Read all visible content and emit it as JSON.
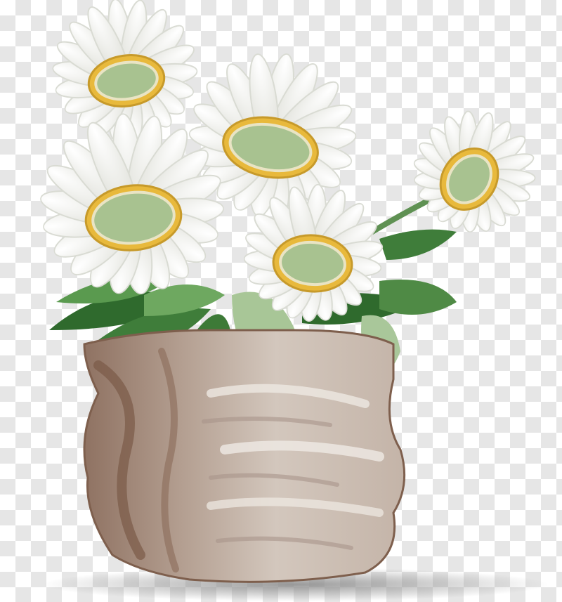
{
  "image": {
    "subject": "daisy-bouquet-in-bark-pot",
    "background": "transparency-checkerboard",
    "flower_count": 5,
    "colors": {
      "checker_light": "#ffffff",
      "checker_dark": "#e6e6e6",
      "petal": "#f3f3ef",
      "petal_shade": "#d9dbd3",
      "center_ring": "#e8b93c",
      "center_disc": "#a8c290",
      "leaf": "#4f8a45",
      "leaf_dark": "#2f5f2c",
      "leaf_pale": "#a9c79a",
      "pot_light": "#d6cbc2",
      "pot_mid": "#b8a596",
      "pot_dark": "#8a6b58",
      "shadow": "#9c9c9c"
    }
  }
}
